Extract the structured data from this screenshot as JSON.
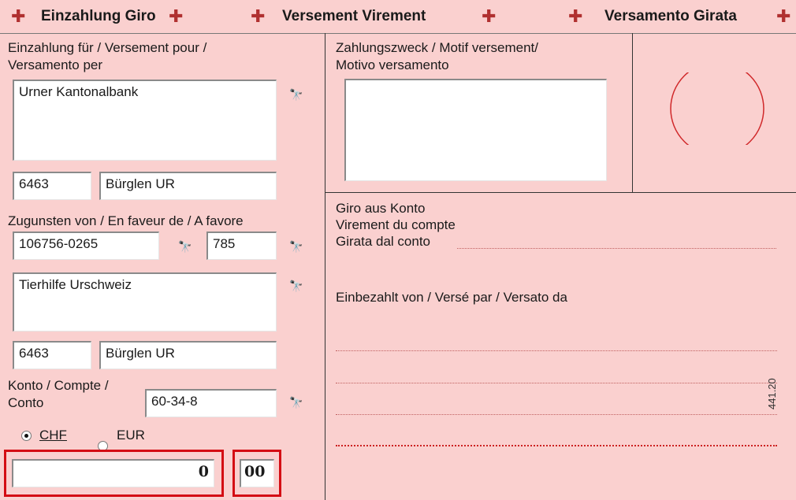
{
  "header": {
    "title_de": "Einzahlung Giro",
    "title_fr": "Versement Virement",
    "title_it": "Versamento Girata",
    "cross_icon": "swiss-cross-icon"
  },
  "left": {
    "bank_label_line1": "Einzahlung für / Versement pour /",
    "bank_label_line2": "Versamento per",
    "bank_name": "Urner Kantonalbank",
    "bank_zip": "6463",
    "bank_city": "Bürglen UR",
    "favour_label": "Zugunsten von / En faveur de / A favore",
    "account_number": "106756-0265",
    "account_suffix": "785",
    "beneficiary_name": "Tierhilfe Urschweiz",
    "beneficiary_zip": "6463",
    "beneficiary_city": "Bürglen UR",
    "konto_label_line1": "Konto / Compte /",
    "konto_label_line2": "Conto",
    "konto_value": "60-34-8",
    "currency_chf": "CHF",
    "currency_eur": "EUR",
    "currency_selected": "CHF",
    "amount_francs": "0",
    "amount_cents": "00",
    "lookup_icon": "binoculars-icon"
  },
  "right": {
    "purpose_label_line1": "Zahlungszweck / Motif versement/",
    "purpose_label_line2": "Motivo versamento",
    "purpose_value": "",
    "giro_label_line1": "Giro aus Konto",
    "giro_label_line2": "Virement du compte",
    "giro_label_line3": "Girata dal conto",
    "payer_label": "Einbezahlt von / Versé par / Versato da",
    "form_code": "441.20"
  },
  "colors": {
    "background": "#fad0cf",
    "stamp_circle": "#d0282a",
    "amount_border": "#d40d14"
  }
}
